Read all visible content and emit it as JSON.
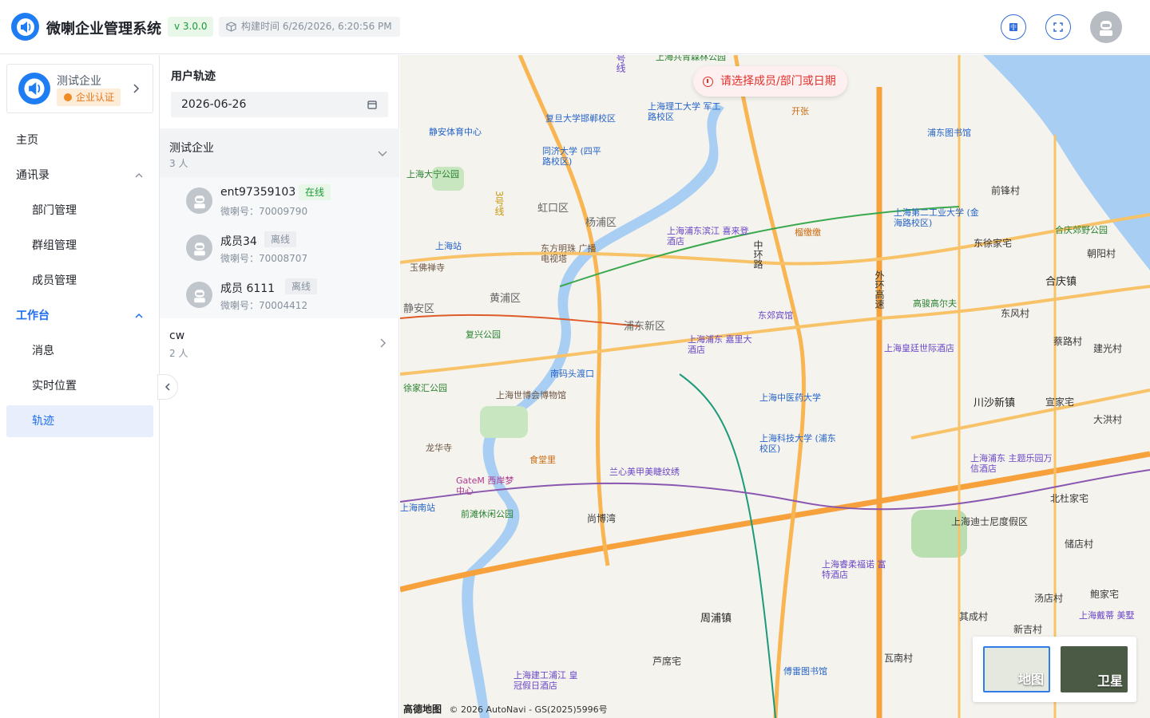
{
  "header": {
    "app_title": "微喇企业管理系统",
    "version": "v 3.0.0",
    "build_time": "构建时间 6/26/2026, 6:20:56 PM",
    "icons": [
      "book-icon",
      "fullscreen-icon",
      "user-avatar"
    ]
  },
  "sidebar": {
    "enterprise": {
      "name": "测试企业",
      "badge": "企业认证"
    },
    "nav": {
      "home": "主页",
      "contacts": "通讯录",
      "dept": "部门管理",
      "groups": "群组管理",
      "members": "成员管理",
      "workbench": "工作台",
      "messages": "消息",
      "realtime": "实时位置",
      "track": "轨迹"
    }
  },
  "panel": {
    "title": "用户轨迹",
    "date": "2026-06-26",
    "groups": [
      {
        "name": "测试企业",
        "count": "3 人"
      },
      {
        "name": "cw",
        "count": "2 人"
      }
    ],
    "members": [
      {
        "name": "ent97359103",
        "id": "微喇号：70009790",
        "status": "在线"
      },
      {
        "name": "成员34",
        "id": "微喇号：70008707",
        "status": "离线"
      },
      {
        "name": "成员 6111",
        "id": "微喇号：70004412",
        "status": "离线"
      }
    ]
  },
  "map": {
    "alert": "请选择成员/部门或日期",
    "switch": {
      "map": "地图",
      "satellite": "卫星"
    },
    "attribution_brand": "高德地图",
    "attribution": "© 2026 AutoNavi - GS(2025)5996号",
    "pois": {
      "p1": "上海共青森林公园",
      "p2": "上海理工大学 军工路校区",
      "p3": "复旦大学邯郸校区",
      "p4": "静安体育中心",
      "p5": "同济大学 (四平路校区)",
      "p6": "上海大宁公园",
      "p7": "开张",
      "p8": "浦东图书馆",
      "p9": "上海站",
      "p10": "玉佛禅寺",
      "p11": "东方明珠 广播电视塔",
      "p12": "上海浦东滨江 喜来登酒店",
      "p13": "榴缴缴",
      "p14": "上海第二工业大学 (金海路校区)",
      "p15": "合庆郊野公园",
      "p16": "复兴公园",
      "p17": "东郊宾馆",
      "p18": "高骏高尔夫",
      "p19": "上海浦东 嘉里大酒店",
      "p20": "上海皇廷世际酒店",
      "p21": "南码头渡口",
      "p22": "徐家汇公园",
      "p23": "上海世博会博物馆",
      "p24": "上海中医药大学",
      "p25": "上海科技大学 (浦东校区)",
      "p26": "龙华寺",
      "p27": "食堂里",
      "p28": "兰心美甲美睫纹绣",
      "p29": "GateM 西岸梦中心",
      "p30": "前滩休闲公园",
      "p31": "上海浦东 主题乐园万信酒店",
      "p32": "上海迪士尼度假区",
      "p33": "上海睿柔福诺 富特酒店",
      "p34": "上海建工浦江 皇冠假日酒店",
      "p35": "傅雷图书馆",
      "p36": "上海戴蒂 美墅"
    },
    "places": {
      "d1": "虹口区",
      "d2": "杨浦区",
      "d3": "黄浦区",
      "d4": "静安区",
      "d5": "浦东新区",
      "t1": "前锋村",
      "t2": "东徐家宅",
      "t3": "朝阳村",
      "t4": "合庆镇",
      "t5": "东风村",
      "t6": "蔡路村",
      "t7": "建光村",
      "t8": "川沙新镇",
      "t9": "宣家宅",
      "t10": "大洪村",
      "t11": "北杜家宅",
      "t12": "储店村",
      "t13": "尚博湾",
      "t14": "汤店村",
      "t15": "鲍家宅",
      "t16": "其成村",
      "t17": "新吉村",
      "t18": "周浦镇",
      "t19": "芦席宅",
      "t20": "瓦南村",
      "r1": "中环路",
      "r2": "外环高速",
      "r3": "号线",
      "r4": "3号线",
      "r5": "上海南站"
    }
  }
}
